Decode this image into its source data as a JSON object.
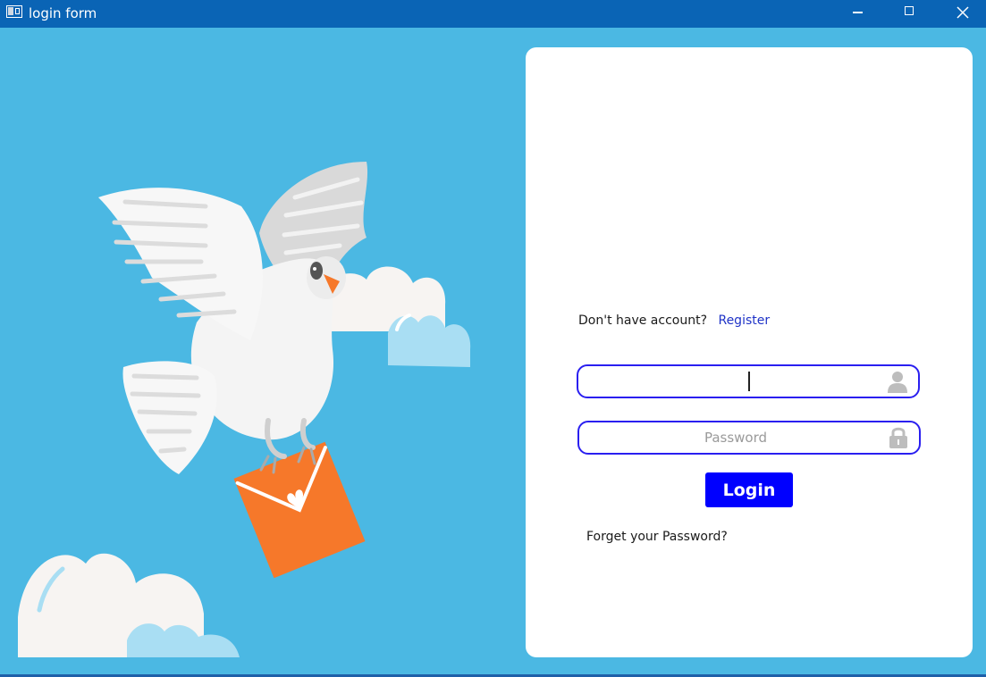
{
  "window": {
    "title": "login form",
    "controls": [
      "minimize",
      "maximize",
      "close"
    ]
  },
  "illustration": {
    "subject": "dove-carrying-envelope",
    "colors": {
      "background": "#4bb8e3",
      "envelope": "#f6782a",
      "cloud": "#f7f4f2",
      "cloud_accent": "#a9def3"
    }
  },
  "login": {
    "prompt": "Don't have account?",
    "register_link": "Register",
    "username": {
      "value": "",
      "placeholder": "",
      "icon": "user-icon"
    },
    "password": {
      "value": "",
      "placeholder": "Password",
      "icon": "lock-icon"
    },
    "login_button": "Login",
    "forgot_link": "Forget your Password?"
  },
  "colors": {
    "accent": "#0000ff",
    "input_border": "#2a1ff0",
    "link": "#1f33c7",
    "titlebar": "#0a64b5"
  }
}
